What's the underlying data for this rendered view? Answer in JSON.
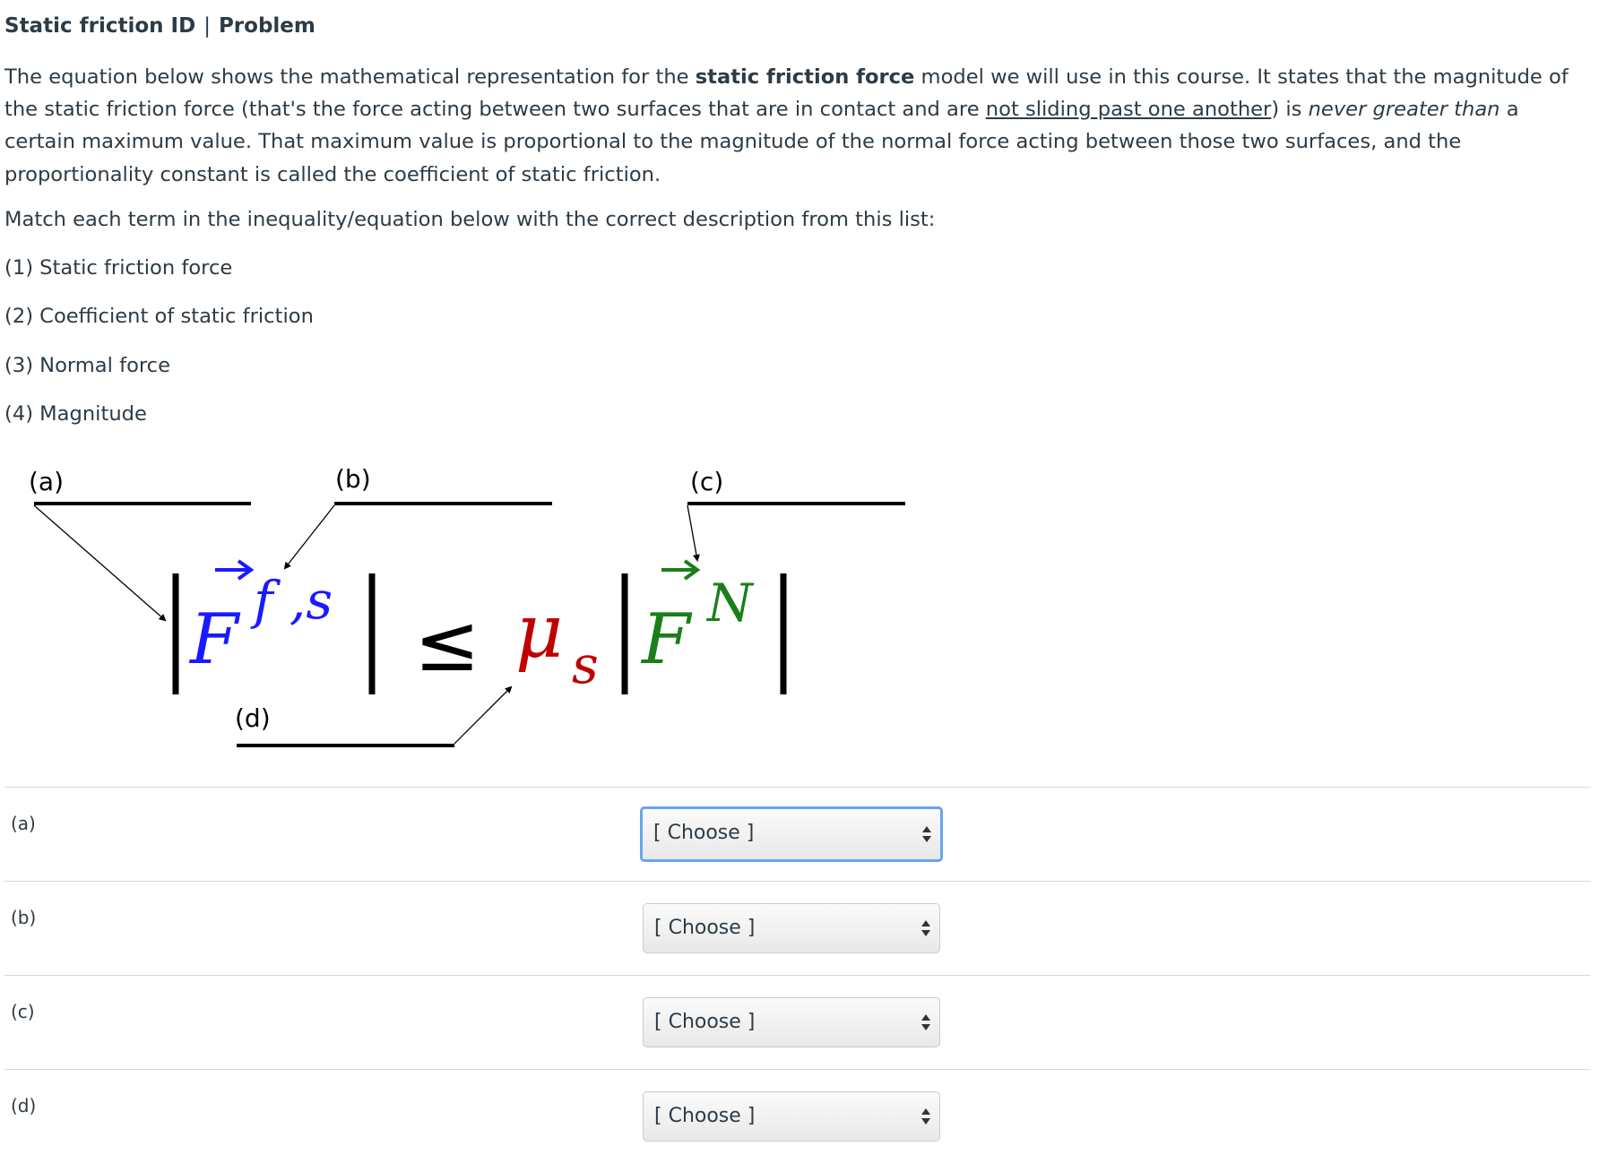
{
  "header": {
    "title_left": "Static friction ID",
    "separator": "|",
    "title_right": "Problem"
  },
  "intro": {
    "p1_a": "The equation below shows the mathematical representation for the ",
    "p1_bold": "static friction force",
    "p1_b": " model we will use in this course.  It states that the magnitude of the static friction force (that's the force acting between two surfaces that are in contact and are ",
    "p1_underline": "not sliding past one another",
    "p1_c": ") is ",
    "p1_italic": "never greater than",
    "p1_d": " a certain maximum value.  That maximum value is proportional to the magnitude of the normal force acting between those two surfaces, and the proportionality constant is called the coefficient of static friction.",
    "instruction": "Match each term in the inequality/equation below with the correct description from this list:",
    "options": [
      "(1) Static friction force",
      "(2) Coefficient of static friction",
      "(3) Normal force",
      "(4) Magnitude"
    ]
  },
  "diagram": {
    "label_a": "(a)",
    "label_b": "(b)",
    "label_c": "(c)",
    "label_d": "(d)",
    "f_symbol": "F",
    "f_sub": "f ,s",
    "leq": "≤",
    "mu": "μ",
    "mu_sub": "s",
    "n_symbol": "F",
    "n_sup": "N",
    "colors": {
      "friction": "#1a1aff",
      "mu": "#c00000",
      "normal": "#1a7f1a"
    }
  },
  "answers": [
    {
      "label": "(a)",
      "select": "[ Choose ]",
      "focused": true
    },
    {
      "label": "(b)",
      "select": "[ Choose ]",
      "focused": false
    },
    {
      "label": "(c)",
      "select": "[ Choose ]",
      "focused": false
    },
    {
      "label": "(d)",
      "select": "[ Choose ]",
      "focused": false
    }
  ]
}
